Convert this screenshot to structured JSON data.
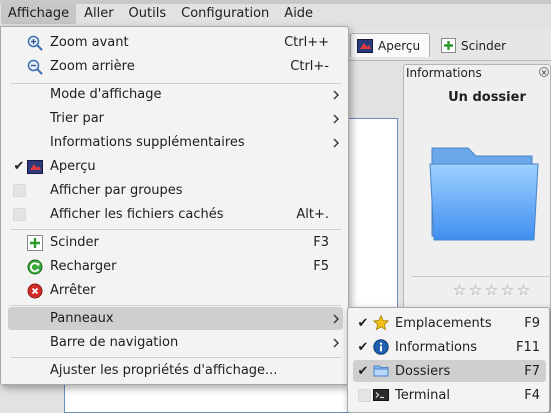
{
  "menubar": {
    "items": [
      {
        "label": "Affichage",
        "active": true
      },
      {
        "label": "Aller"
      },
      {
        "label": "Outils"
      },
      {
        "label": "Configuration"
      },
      {
        "label": "Aide"
      }
    ]
  },
  "background": {
    "tabs": [
      {
        "label": "Aperçu",
        "icon": "preview-icon"
      },
      {
        "label": "Scinder",
        "icon": "split-icon"
      }
    ],
    "info_panel": {
      "header": "Informations",
      "title": "Un dossier",
      "rating": 0,
      "rating_max": 5,
      "icon": "folder-icon"
    }
  },
  "menu": {
    "zoom_in": {
      "label": "Zoom avant",
      "shortcut": "Ctrl++"
    },
    "zoom_out": {
      "label": "Zoom arrière",
      "shortcut": "Ctrl+-"
    },
    "view_mode": {
      "label": "Mode d'affichage"
    },
    "sort_by": {
      "label": "Trier par"
    },
    "additional_info": {
      "label": "Informations supplémentaires"
    },
    "preview": {
      "label": "Aperçu",
      "checked": true
    },
    "show_groups": {
      "label": "Afficher par groupes",
      "checked": false
    },
    "show_hidden": {
      "label": "Afficher les fichiers cachés",
      "shortcut": "Alt+.",
      "checked": false
    },
    "split": {
      "label": "Scinder",
      "shortcut": "F3"
    },
    "reload": {
      "label": "Recharger",
      "shortcut": "F5"
    },
    "stop": {
      "label": "Arrêter"
    },
    "panels": {
      "label": "Panneaux"
    },
    "nav_bar": {
      "label": "Barre de navigation"
    },
    "adjust": {
      "label": "Ajuster les propriétés d'affichage..."
    }
  },
  "submenu": {
    "places": {
      "label": "Emplacements",
      "shortcut": "F9",
      "checked": true
    },
    "information": {
      "label": "Informations",
      "shortcut": "F11",
      "checked": true
    },
    "folders": {
      "label": "Dossiers",
      "shortcut": "F7",
      "checked": true
    },
    "terminal": {
      "label": "Terminal",
      "shortcut": "F4",
      "checked": false
    }
  },
  "colors": {
    "accent": "#3a7bd5",
    "highlight": "#cfcfcf",
    "menu_bg": "#f3f3f3"
  }
}
